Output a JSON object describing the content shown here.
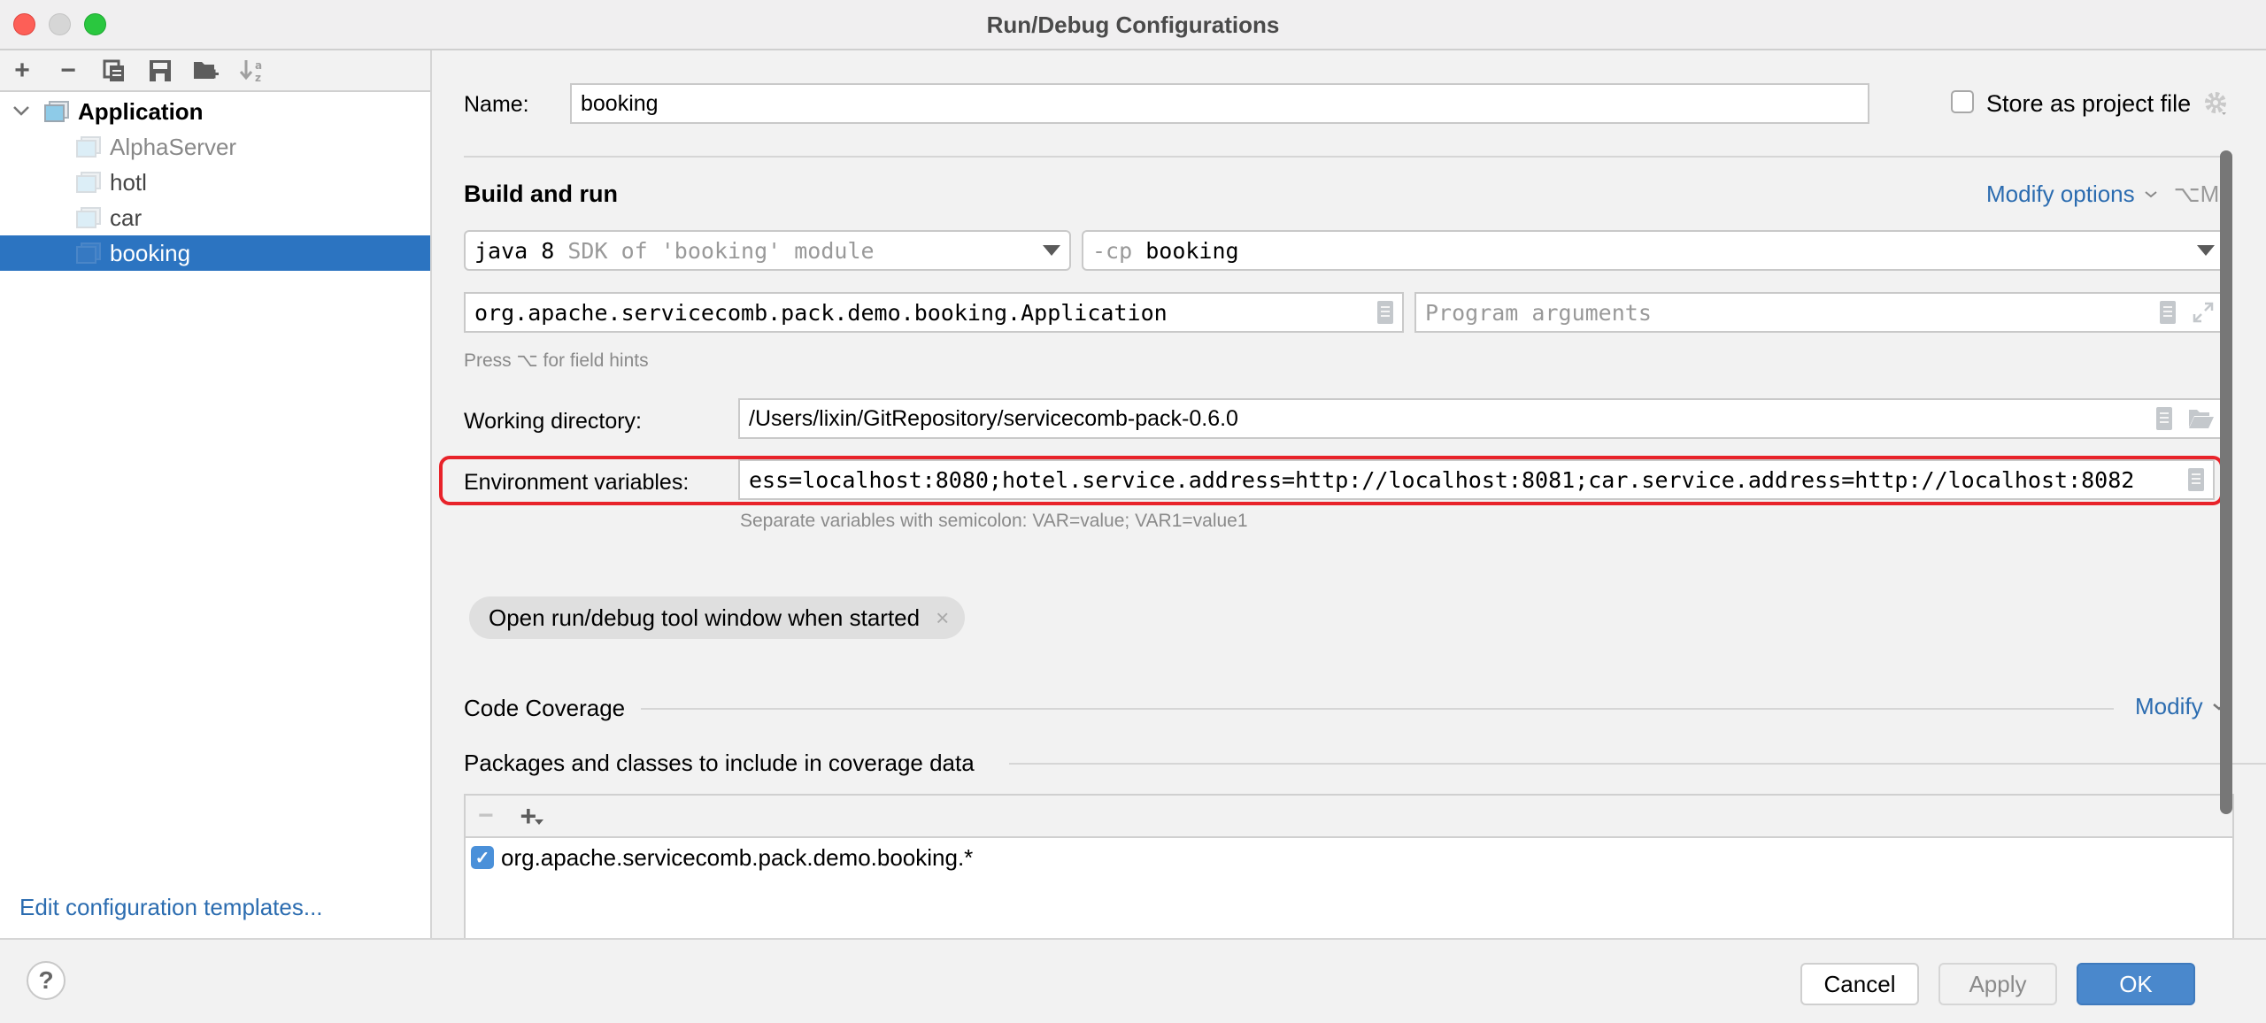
{
  "window": {
    "title": "Run/Debug Configurations",
    "traffic_lights": {
      "close": "#fd5f57",
      "minimize": "#d6d6d6",
      "maximize": "#2ac73f"
    }
  },
  "sidebar": {
    "toolbar": [
      {
        "name": "add-icon",
        "glyph": "+"
      },
      {
        "name": "remove-icon",
        "glyph": "−"
      },
      {
        "name": "copy-icon",
        "glyph": "⧉"
      },
      {
        "name": "save-icon",
        "glyph": "💾"
      },
      {
        "name": "new-folder-icon",
        "glyph": "📁"
      },
      {
        "name": "sort-alpha-icon",
        "glyph": "↓a/z"
      }
    ],
    "tree": {
      "group": {
        "label": "Application",
        "expanded": true
      },
      "items": [
        {
          "label": "AlphaServer",
          "selected": false
        },
        {
          "label": "hotl",
          "selected": false
        },
        {
          "label": "car",
          "selected": false
        },
        {
          "label": "booking",
          "selected": true
        }
      ]
    },
    "edit_templates_link": "Edit configuration templates..."
  },
  "main": {
    "name_label": "Name:",
    "name_value": "booking",
    "store_as_project_file": {
      "label": "Store as project file",
      "checked": false
    },
    "build_and_run": {
      "heading": "Build and run",
      "modify_options": "Modify options",
      "modify_shortcut": "⌥M",
      "jdk": {
        "value": "java 8",
        "detail": "SDK of 'booking' module"
      },
      "classpath": {
        "prefix": "-cp",
        "value": "booking"
      },
      "main_class": "org.apache.servicecomb.pack.demo.booking.Application",
      "program_args_placeholder": "Program arguments",
      "field_hint": "Press ⌥ for field hints"
    },
    "working_directory": {
      "label": "Working directory:",
      "value": "/Users/lixin/GitRepository/servicecomb-pack-0.6.0"
    },
    "environment_variables": {
      "label": "Environment variables:",
      "value": "ess=localhost:8080;hotel.service.address=http://localhost:8081;car.service.address=http://localhost:8082",
      "helper": "Separate variables with semicolon: VAR=value; VAR1=value1",
      "highlight_color": "#e8232a"
    },
    "option_chip": {
      "label": "Open run/debug tool window when started",
      "close": "×"
    },
    "code_coverage": {
      "heading": "Code Coverage",
      "modify": "Modify",
      "packages_heading": "Packages and classes to include in coverage data",
      "toolbar": {
        "remove": "−",
        "add": "+"
      },
      "entries": [
        {
          "checked": true,
          "pattern": "org.apache.servicecomb.pack.demo.booking.*"
        }
      ]
    }
  },
  "footer": {
    "help": "?",
    "cancel": "Cancel",
    "apply": "Apply",
    "ok": "OK"
  },
  "colors": {
    "accent": "#2c74c1",
    "link": "#2b6cb0",
    "ok_button": "#4a88cc"
  }
}
